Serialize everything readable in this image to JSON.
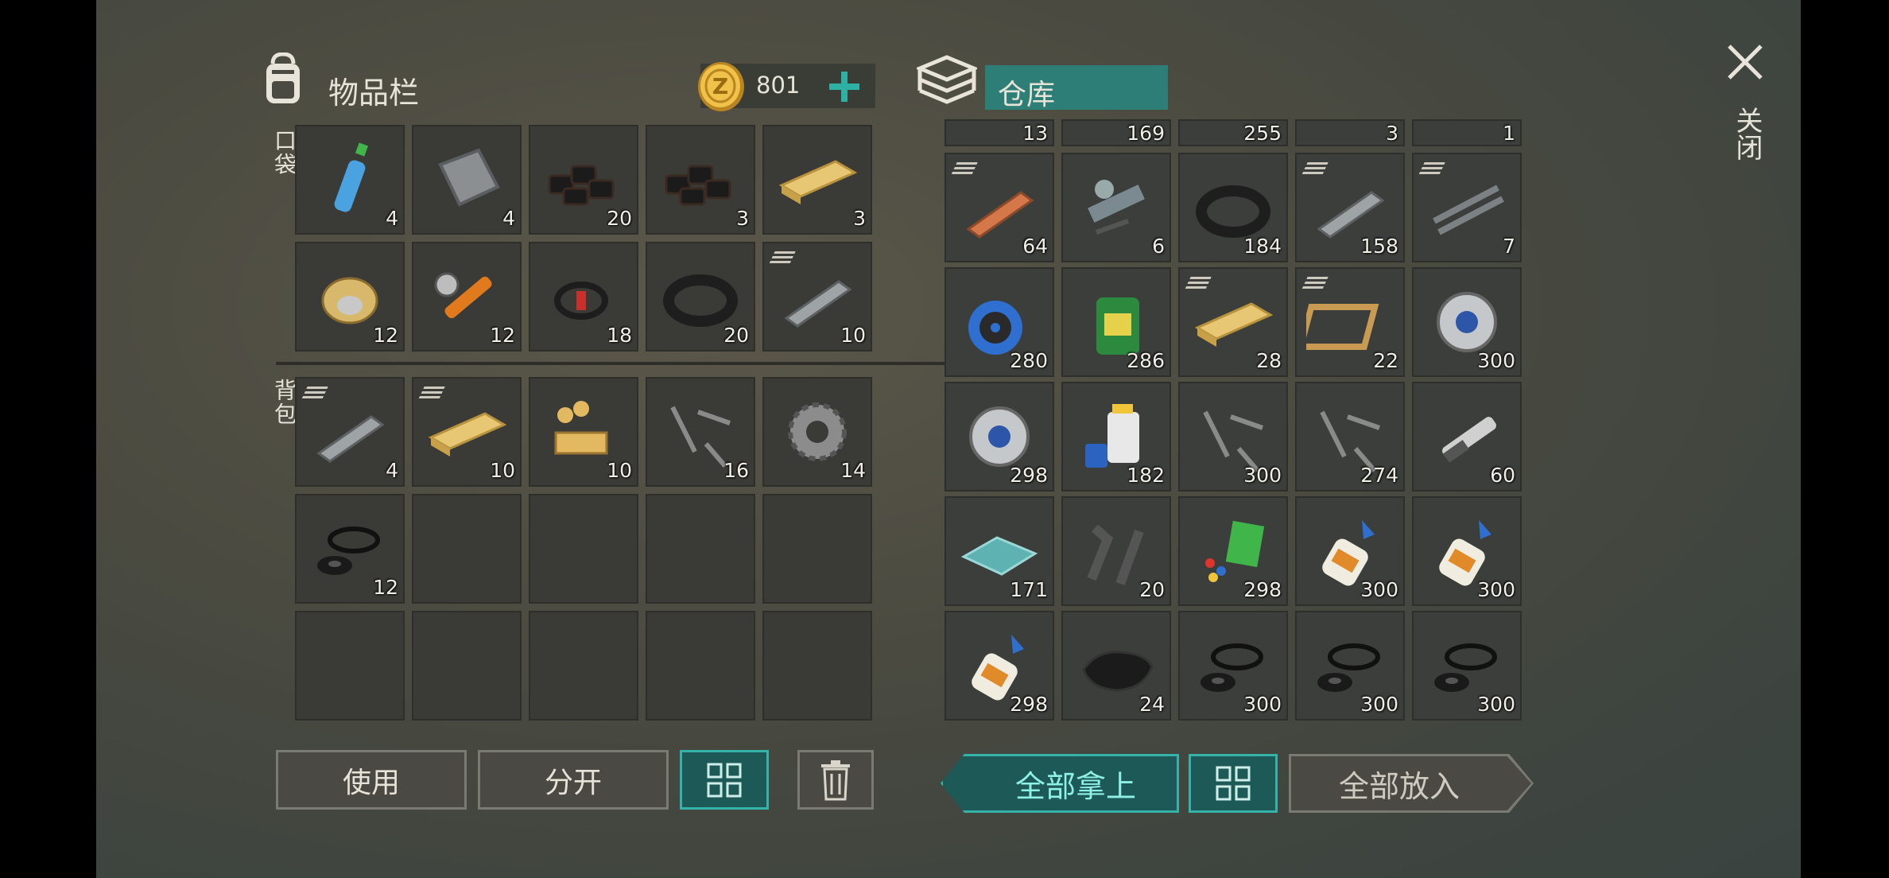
{
  "inventory": {
    "title": "物品栏",
    "coins": "801",
    "pockets_label": "口袋",
    "backpack_label": "背包",
    "pocket_slots": [
      {
        "item": "water-bottle",
        "count": "4"
      },
      {
        "item": "iron-plate",
        "count": "4"
      },
      {
        "item": "coal",
        "count": "20"
      },
      {
        "item": "coal",
        "count": "3"
      },
      {
        "item": "wooden-board",
        "count": "3"
      },
      {
        "item": "wire-spool",
        "count": "12"
      },
      {
        "item": "hydraulic-cylinder",
        "count": "12"
      },
      {
        "item": "electrical-wire",
        "count": "18"
      },
      {
        "item": "rubber-hose",
        "count": "20"
      },
      {
        "item": "iron-bar",
        "count": "10",
        "stacked": true
      }
    ],
    "backpack_slots": [
      {
        "item": "iron-bar",
        "count": "4",
        "stacked": true
      },
      {
        "item": "wooden-board",
        "count": "10",
        "stacked": true
      },
      {
        "item": "wooden-parts",
        "count": "10"
      },
      {
        "item": "screws",
        "count": "16"
      },
      {
        "item": "gear",
        "count": "14"
      },
      {
        "item": "rubber-seals",
        "count": "12"
      },
      {
        "item": "",
        "count": ""
      },
      {
        "item": "",
        "count": ""
      },
      {
        "item": "",
        "count": ""
      },
      {
        "item": "",
        "count": ""
      },
      {
        "item": "",
        "count": ""
      },
      {
        "item": "",
        "count": ""
      },
      {
        "item": "",
        "count": ""
      },
      {
        "item": "",
        "count": ""
      },
      {
        "item": "",
        "count": ""
      }
    ],
    "buttons": {
      "use": "使用",
      "split": "分开"
    }
  },
  "storage": {
    "title": "仓库",
    "partial_row": [
      "13",
      "169",
      "255",
      "3",
      "1"
    ],
    "slots": [
      {
        "item": "copper-bar",
        "count": "64",
        "stacked": true
      },
      {
        "item": "engine-parts",
        "count": "6"
      },
      {
        "item": "rubber-hose",
        "count": "184"
      },
      {
        "item": "iron-bar",
        "count": "158",
        "stacked": true
      },
      {
        "item": "rebar",
        "count": "7",
        "stacked": true
      },
      {
        "item": "blue-wire-spool",
        "count": "280"
      },
      {
        "item": "motor-oil",
        "count": "286"
      },
      {
        "item": "wooden-board",
        "count": "28",
        "stacked": true
      },
      {
        "item": "wooden-frame",
        "count": "22",
        "stacked": true
      },
      {
        "item": "pulley",
        "count": "300"
      },
      {
        "item": "pulley",
        "count": "298"
      },
      {
        "item": "resin",
        "count": "182"
      },
      {
        "item": "screws",
        "count": "300"
      },
      {
        "item": "screws",
        "count": "274"
      },
      {
        "item": "spark-plug",
        "count": "60"
      },
      {
        "item": "glass",
        "count": "171"
      },
      {
        "item": "pipes",
        "count": "20"
      },
      {
        "item": "plastic",
        "count": "298"
      },
      {
        "item": "glue",
        "count": "300"
      },
      {
        "item": "glue",
        "count": "300"
      },
      {
        "item": "glue",
        "count": "298"
      },
      {
        "item": "leather",
        "count": "24"
      },
      {
        "item": "rubber-seals",
        "count": "300"
      },
      {
        "item": "rubber-seals",
        "count": "300"
      },
      {
        "item": "rubber-seals",
        "count": "300"
      }
    ],
    "buttons": {
      "take_all": "全部拿上",
      "put_all": "全部放入"
    }
  },
  "close_label": "关闭",
  "colors": {
    "accent": "#2aa79c",
    "coin": "#e3b23a",
    "cyan_panel": "#2e7e78"
  }
}
